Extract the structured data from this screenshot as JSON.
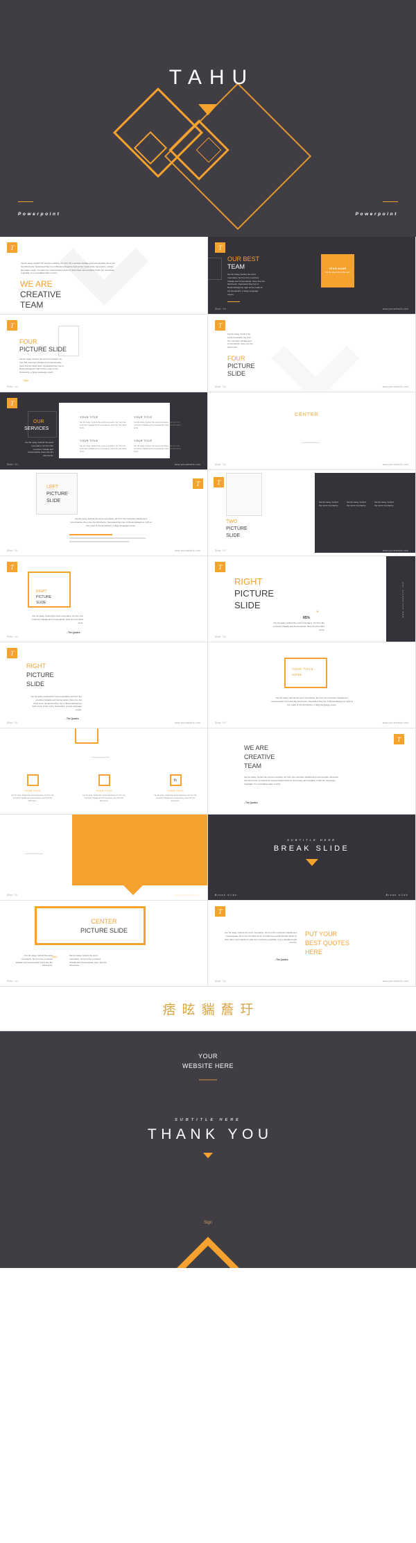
{
  "brand": {
    "logo_letter": "T",
    "accent": "#f5a22e",
    "dark": "#403d45",
    "slide_dark": "#35323a"
  },
  "hero": {
    "title": "TAHU",
    "left_label": "Powerpoint",
    "right_label": "Powerpoint"
  },
  "footer_common": {
    "slide_number": "Slide / 01",
    "website": "www.yourwebsite.com",
    "break_left": "Break slide",
    "break_right": "Break slide"
  },
  "lorem": {
    "long": "Far far away, behind the word mountains, far from the countries Vokalia and Consonantia, there live the blind texts. Separated they live in Bookmarksgrove right at the coast of the Semantics, a large language ocean. A small river named Duden flows by their place and supplies it with the necessary regelialia. It is a paradisematic country.",
    "mid": "Far far away, behind the word mountains, far from the countries Vokalia and Consonantia, there live the blind texts. Separated they live in Bookmarksgrove right at the coast of the Semantics, a large language ocean.",
    "short": "Far far away, behind the word mountains, far from the countries Vokalia and Consonantia, there live the blind texts.",
    "tiny": "Far far away, behind the word mountains.",
    "quote": "Far far away, behind the word mountains, far from the countries Vokalia and Consonantia, there live the blind texts. A small river named Duden flows by their place and supplies it with the necessary regelialia. It is a paradisematic country.",
    "quote_author": "- The Quotes"
  },
  "slides": {
    "we_are_creative": {
      "l1": "WE ARE",
      "l2": "CREATIVE",
      "l3": "TEAM"
    },
    "our_best_team": {
      "l1": "OUR BEST",
      "l2": "TEAM",
      "tile_title": "TEAM NAME",
      "tile_body": "Far far away, behind the word"
    },
    "four_picture_a": {
      "l1": "FOUR",
      "l2": "PICTURE SLIDE"
    },
    "four_picture_b": {
      "l1": "FOUR",
      "l2": "PICTURE",
      "l3": "SLIDE"
    },
    "our_services": {
      "l1": "OUR",
      "l2": "SERVICES",
      "quad_title": "YOUR TITLE",
      "quads": [
        {
          "title": "YOUR TITLE"
        },
        {
          "title": "YOUR TITLE"
        },
        {
          "title": "YOUR TITLE"
        },
        {
          "title": "YOUR TITLE"
        }
      ]
    },
    "center": {
      "l1": "CENTER"
    },
    "left_picture": {
      "l1": "LEFT",
      "l2": "PICTURE",
      "l3": "SLIDE"
    },
    "two_picture": {
      "l1": "TWO",
      "l2": "PICTURE",
      "l3": "SLIDE"
    },
    "right_picture_small": {
      "l1": "RIGHT",
      "l2": "PICTURE",
      "l3": "SLIDE"
    },
    "right_picture_big": {
      "l1": "RIGHT",
      "l2": "PICTURE",
      "l3": "SLIDE",
      "percent": "85%",
      "vertical_web": "www.yourwebsite.com"
    },
    "right_picture_3": {
      "l1": "RIGHT",
      "l2": "PICTURE",
      "l3": "SLIDE"
    },
    "your_title_box": {
      "l1": "YOUR TITLE",
      "l2": "HERE"
    },
    "icons_row": {
      "items": [
        {
          "title": "YOUR TITLE",
          "icon": "square-icon"
        },
        {
          "title": "YOUR TITLE",
          "icon": "square-icon"
        },
        {
          "title": "YOUR TITLE",
          "icon": "facebook-icon",
          "glyph": "fb"
        }
      ]
    },
    "we_are_creative_2": {
      "l1": "WE ARE",
      "l2": "CREATIVE",
      "l3": "TEAM"
    },
    "break_slide": {
      "subtitle": "SUBTITLE HERE",
      "title": "BREAK SLIDE"
    },
    "center_picture": {
      "l1": "CENTER",
      "l2": "PICTURE SLIDE",
      "sign": "Sign"
    },
    "best_quotes": {
      "l1": "PUT YOUR",
      "l2": "BEST QUOTES",
      "l3": "HERE"
    }
  },
  "cjk_band": {
    "text": "痞昡貒薝玗"
  },
  "outro": {
    "website_l1": "YOUR",
    "website_l2": "WEBSITE HERE",
    "subtitle": "SUBTITLE HERE",
    "title": "THANK YOU",
    "sign": "Sign"
  }
}
